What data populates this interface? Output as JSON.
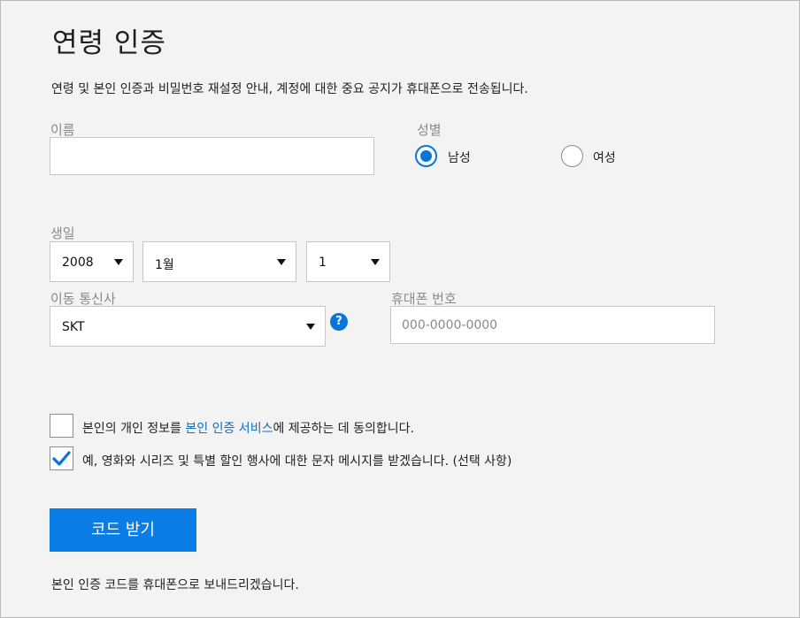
{
  "title": "연령 인증",
  "description": "연령 및 본인 인증과 비밀번호 재설정 안내, 계정에 대한 중요 공지가 휴대폰으로 전송됩니다.",
  "name_field": {
    "label": "이름",
    "value": ""
  },
  "gender": {
    "label": "성별",
    "options": [
      {
        "label": "남성",
        "selected": true
      },
      {
        "label": "여성",
        "selected": false
      }
    ]
  },
  "birthday": {
    "label": "생일",
    "year": "2008",
    "month": "1월",
    "day": "1"
  },
  "carrier": {
    "label": "이동 통신사",
    "value": "SKT",
    "help_icon": "question-circle-icon"
  },
  "phone": {
    "label": "휴대폰 번호",
    "placeholder": "000-0000-0000"
  },
  "consent": {
    "text_before": "본인의 개인 정보를 ",
    "link": "본인 인증 서비스",
    "text_after": "에 제공하는 데 동의합니다.",
    "checked": false
  },
  "marketing": {
    "text": "예, 영화와 시리즈 및 특별 할인 행사에 대한 문자 메시지를 받겠습니다. (선택 사항)",
    "checked": true
  },
  "submit_label": "코드 받기",
  "footer": "본인 인증 코드를 휴대폰으로 보내드리겠습니다.",
  "colors": {
    "accent": "#0a75d8",
    "button": "#0a7ce6",
    "background": "#f3f3f3"
  }
}
